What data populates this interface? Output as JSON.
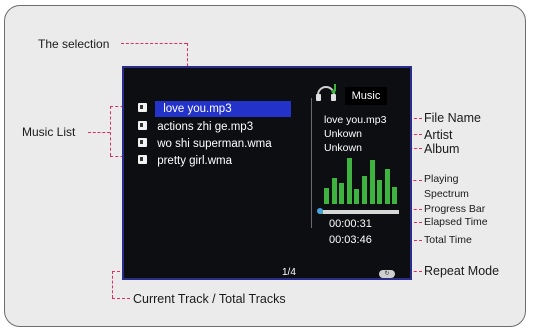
{
  "annotations": {
    "selection": "The selection",
    "music_list": "Music List",
    "file_name": "File Name",
    "artist": "Artist",
    "album": "Album",
    "playing_spectrum": [
      "Playing",
      "Spectrum"
    ],
    "progress_bar": "Progress Bar",
    "elapsed_time": "Elapsed Time",
    "total_time": "Total Time",
    "repeat_mode": "Repeat Mode",
    "current_total": "Current Track / Total Tracks"
  },
  "player": {
    "tracks": [
      {
        "name": "love you.mp3",
        "selected": true
      },
      {
        "name": "actions zhi ge.mp3",
        "selected": false
      },
      {
        "name": "wo shi superman.wma",
        "selected": false
      },
      {
        "name": "pretty girl.wma",
        "selected": false
      }
    ],
    "mode_label": "Music",
    "file_name": "love you.mp3",
    "artist": "Unkown",
    "album": "Unkown",
    "elapsed": "00:00:31",
    "total": "00:03:46",
    "track_counter": "1/4",
    "progress": 0.05,
    "spectrum_levels": [
      0.32,
      0.52,
      0.42,
      0.92,
      0.3,
      0.55,
      0.88,
      0.48,
      0.7,
      0.33
    ],
    "accent_color": "#3fb33f",
    "selection_color": "#2332c9",
    "leader_color": "#d8306a"
  }
}
